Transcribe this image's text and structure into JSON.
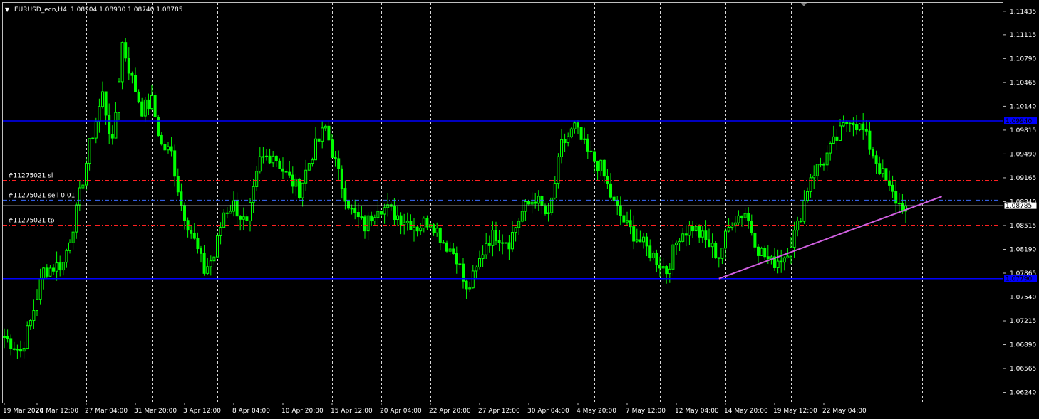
{
  "header": {
    "menu_glyph": "▼",
    "symbol_label": "EURUSD_ecn,H4",
    "ohlc_text": "1.08904 1.08930 1.08740 1.08785"
  },
  "colors": {
    "background": "#000000",
    "frame": "#bfbfbf",
    "grid": "#ffffff",
    "candle": "#00ff00",
    "sr_line": "#0000ff",
    "sl_tp_line": "#ff2020",
    "entry_line": "#3a6bff",
    "bid_line": "#c0c0c0",
    "trend_line": "#d060e0",
    "label_text": "#ffffff"
  },
  "chart_data": {
    "type": "candlestick",
    "symbol": "EURUSD_ecn",
    "timeframe": "H4",
    "ylim": [
      1.061,
      1.1155
    ],
    "y_ticks": [
      "1.11435",
      "1.11115",
      "1.10790",
      "1.10465",
      "1.10140",
      "1.09815",
      "1.09490",
      "1.09165",
      "1.08840",
      "1.08515",
      "1.08190",
      "1.07865",
      "1.07540",
      "1.07215",
      "1.06890",
      "1.06565",
      "1.06240"
    ],
    "x_ticks": [
      "19 Mar 2020",
      "24 Mar 12:00",
      "27 Mar 04:00",
      "31 Mar 20:00",
      "3 Apr 12:00",
      "8 Apr 04:00",
      "10 Apr 20:00",
      "15 Apr 12:00",
      "20 Apr 04:00",
      "22 Apr 20:00",
      "27 Apr 12:00",
      "30 Apr 04:00",
      "4 May 20:00",
      "7 May 12:00",
      "12 May 04:00",
      "14 May 20:00",
      "19 May 12:00",
      "22 May 04:00"
    ],
    "x_tick_index": [
      0,
      10,
      25,
      40,
      55,
      70,
      85,
      100,
      115,
      130,
      145,
      160,
      175,
      190,
      205,
      220,
      235,
      250
    ],
    "vertical_grid_index": [
      5,
      25,
      45,
      65,
      80,
      100,
      115,
      130,
      145,
      160,
      180,
      200,
      220,
      240,
      260,
      280
    ],
    "grid": true,
    "bar_count": 262,
    "future_bars": 25,
    "close_anchors": [
      [
        0,
        1.07
      ],
      [
        5,
        1.068
      ],
      [
        8,
        1.072
      ],
      [
        12,
        1.079
      ],
      [
        18,
        1.08
      ],
      [
        22,
        1.087
      ],
      [
        26,
        1.096
      ],
      [
        30,
        1.103
      ],
      [
        33,
        1.096
      ],
      [
        36,
        1.11
      ],
      [
        39,
        1.105
      ],
      [
        42,
        1.101
      ],
      [
        45,
        1.102
      ],
      [
        48,
        1.096
      ],
      [
        51,
        1.095
      ],
      [
        54,
        1.088
      ],
      [
        58,
        1.083
      ],
      [
        61,
        1.079
      ],
      [
        64,
        1.081
      ],
      [
        67,
        1.087
      ],
      [
        70,
        1.088
      ],
      [
        74,
        1.085
      ],
      [
        78,
        1.094
      ],
      [
        82,
        1.095
      ],
      [
        86,
        1.092
      ],
      [
        90,
        1.09
      ],
      [
        94,
        1.095
      ],
      [
        98,
        1.0985
      ],
      [
        102,
        1.092
      ],
      [
        106,
        1.087
      ],
      [
        110,
        1.085
      ],
      [
        114,
        1.088
      ],
      [
        118,
        1.087
      ],
      [
        122,
        1.086
      ],
      [
        126,
        1.085
      ],
      [
        130,
        1.086
      ],
      [
        134,
        1.083
      ],
      [
        138,
        1.081
      ],
      [
        141,
        1.076
      ],
      [
        144,
        1.079
      ],
      [
        147,
        1.083
      ],
      [
        150,
        1.084
      ],
      [
        154,
        1.083
      ],
      [
        158,
        1.087
      ],
      [
        162,
        1.089
      ],
      [
        166,
        1.086
      ],
      [
        170,
        1.096
      ],
      [
        174,
        1.0985
      ],
      [
        178,
        1.095
      ],
      [
        182,
        1.093
      ],
      [
        186,
        1.088
      ],
      [
        190,
        1.085
      ],
      [
        194,
        1.083
      ],
      [
        198,
        1.081
      ],
      [
        202,
        1.079
      ],
      [
        206,
        1.084
      ],
      [
        210,
        1.085
      ],
      [
        214,
        1.083
      ],
      [
        218,
        1.081
      ],
      [
        222,
        1.086
      ],
      [
        226,
        1.087
      ],
      [
        230,
        1.082
      ],
      [
        234,
        1.08
      ],
      [
        238,
        1.081
      ],
      [
        242,
        1.085
      ],
      [
        246,
        1.092
      ],
      [
        250,
        1.094
      ],
      [
        254,
        1.097
      ],
      [
        258,
        1.1
      ],
      [
        262,
        1.098
      ],
      [
        266,
        1.094
      ],
      [
        270,
        1.09
      ],
      [
        273,
        1.088
      ],
      [
        275,
        1.0878
      ]
    ],
    "horizontal_lines": [
      {
        "kind": "resistance",
        "price": 1.0994,
        "badge": "1.09940"
      },
      {
        "kind": "support",
        "price": 1.0779,
        "badge": "1.07790"
      }
    ],
    "order_lines": [
      {
        "label": "#11275021 sl",
        "price": 1.0913,
        "style": "sl"
      },
      {
        "label": "#11275021 sell 0.01",
        "price": 1.0886,
        "style": "entry"
      },
      {
        "label": "#11275021 tp",
        "price": 1.0852,
        "style": "tp"
      }
    ],
    "bid": {
      "price": 1.08785,
      "badge": "1.08785"
    },
    "trend_line": {
      "from": [
        218,
        1.0779
      ],
      "to": [
        286,
        1.0891
      ]
    }
  }
}
